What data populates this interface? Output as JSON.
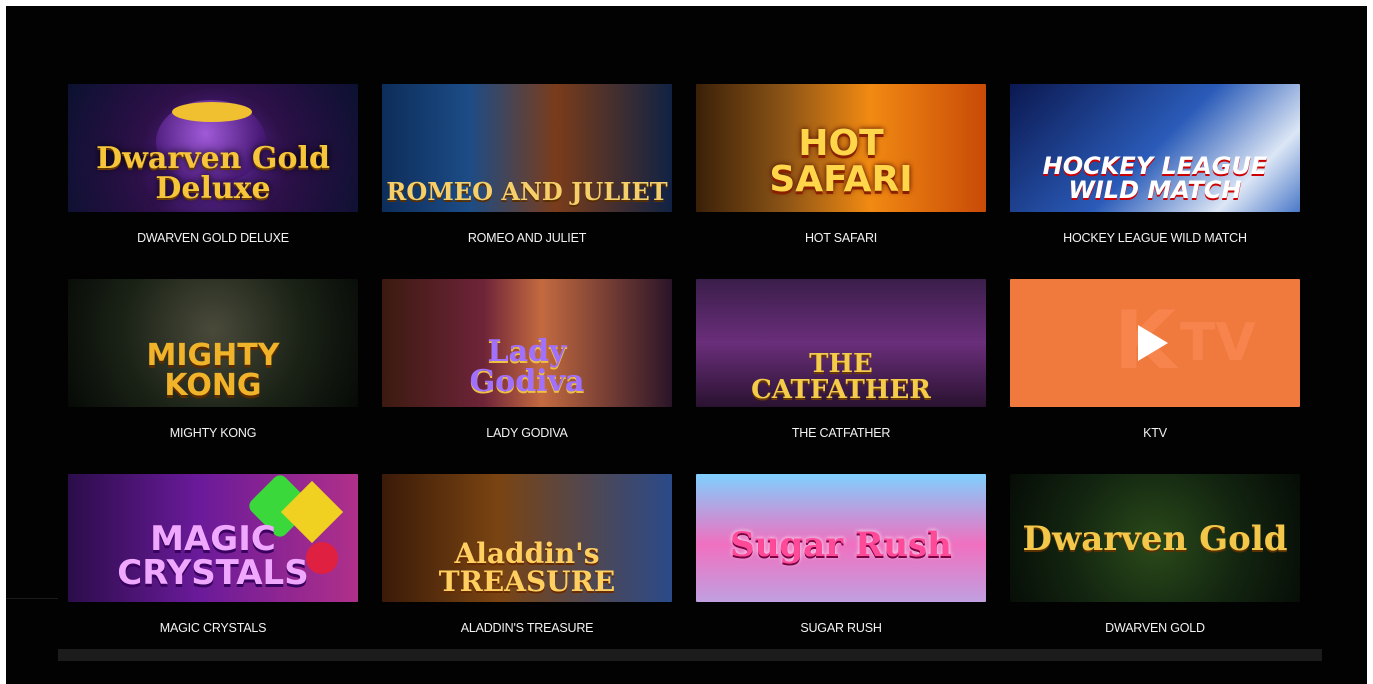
{
  "games": [
    {
      "title": "DWARVEN GOLD DELUXE",
      "logo": "Dwarven Gold Deluxe",
      "icon": "game-thumbnail"
    },
    {
      "title": "ROMEO AND JULIET",
      "logo": "ROMEO AND JULIET",
      "icon": "game-thumbnail"
    },
    {
      "title": "HOT SAFARI",
      "logo": "HOT\nSAFARI",
      "icon": "game-thumbnail"
    },
    {
      "title": "HOCKEY LEAGUE WILD MATCH",
      "logo": "HOCKEY LEAGUE\nWILD MATCH",
      "icon": "game-thumbnail"
    },
    {
      "title": "MIGHTY KONG",
      "logo": "MIGHTY\nKONG",
      "icon": "game-thumbnail"
    },
    {
      "title": "LADY GODIVA",
      "logo": "Lady\nGodiva",
      "icon": "game-thumbnail"
    },
    {
      "title": "THE CATFATHER",
      "logo": "THE\nCATFATHER",
      "icon": "game-thumbnail"
    },
    {
      "title": "KTV",
      "logo": "",
      "icon": "play-icon"
    },
    {
      "title": "MAGIC CRYSTALS",
      "logo": "MAGIC\nCRYSTALS",
      "icon": "game-thumbnail"
    },
    {
      "title": "ALADDIN'S TREASURE",
      "logo": "Aladdin's\nTREASURE",
      "icon": "game-thumbnail"
    },
    {
      "title": "SUGAR RUSH",
      "logo": "Sugar Rush",
      "icon": "game-thumbnail"
    },
    {
      "title": "DWARVEN GOLD",
      "logo": "Dwarven Gold",
      "icon": "game-thumbnail"
    }
  ],
  "ktv_logo": {
    "k": "K",
    "tv": "TV"
  },
  "colors": {
    "background": "#020202",
    "caption": "#f2f2f2",
    "ktv_orange": "#f07a3e"
  }
}
